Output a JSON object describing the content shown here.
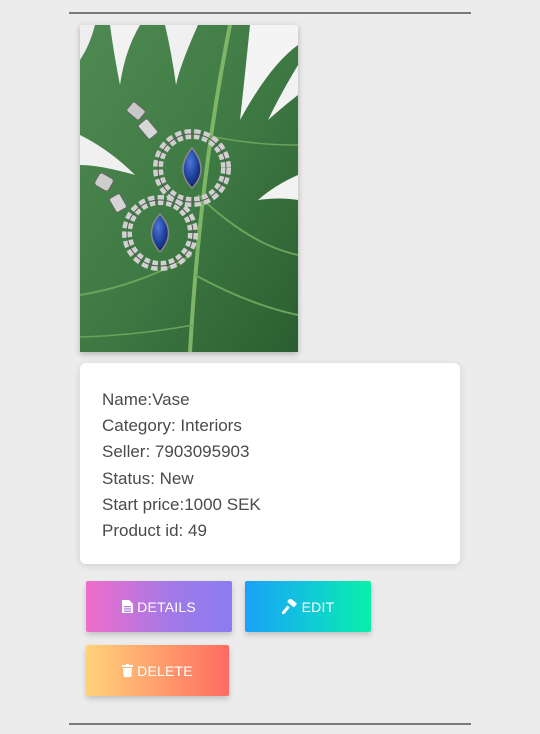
{
  "product": {
    "image_alt": "crystal earrings on a green leaf",
    "name_line": "Name:Vase",
    "category_line": "Category: Interiors",
    "seller_line": "Seller: 7903095903",
    "status_line": "Status: New",
    "start_price_line": "Start price:1000 SEK",
    "product_id_line": "Product id: 49"
  },
  "actions": {
    "details_label": "DETAILS",
    "edit_label": "EDIT",
    "delete_label": "DELETE",
    "details_icon": "file-icon",
    "edit_icon": "hammer-icon",
    "delete_icon": "trash-icon"
  },
  "colors": {
    "background": "#ececec",
    "details_gradient": [
      "#f06dcb",
      "#8b7cf0"
    ],
    "edit_gradient": [
      "#1aa2f8",
      "#08f0a8"
    ],
    "delete_gradient": [
      "#ffd27a",
      "#ff6a62"
    ]
  }
}
